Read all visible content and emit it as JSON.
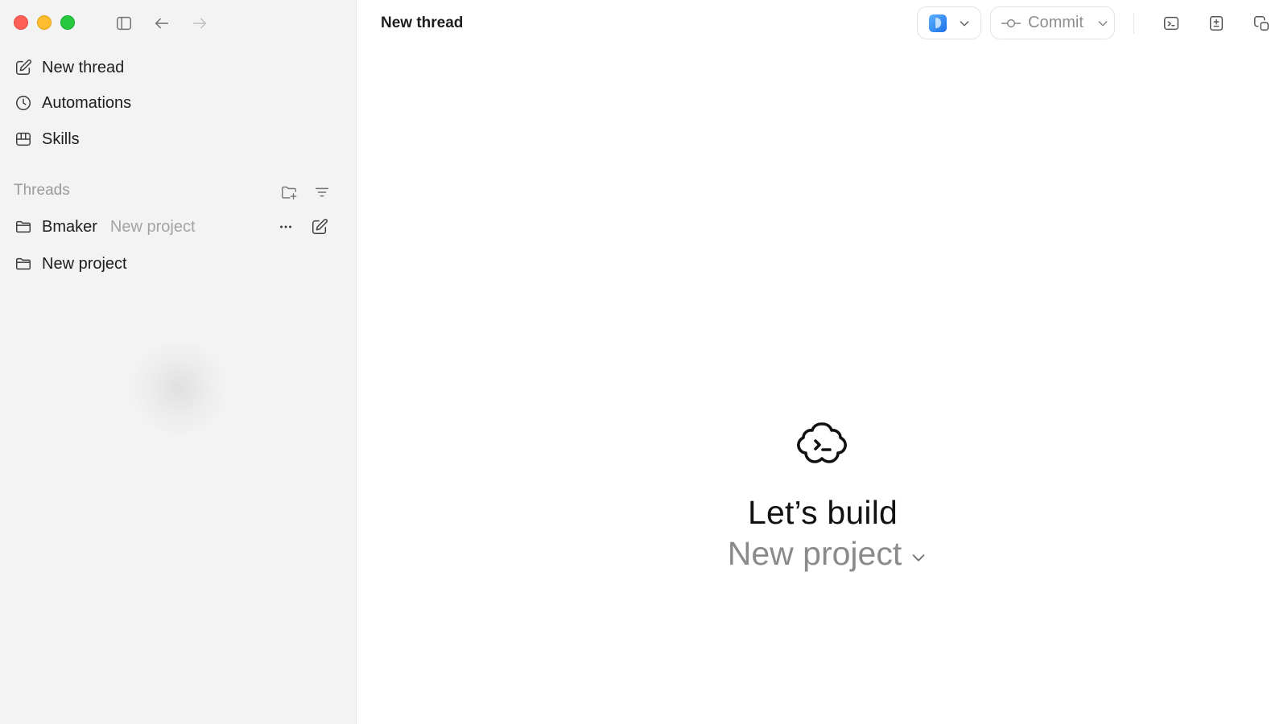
{
  "window": {
    "title": "New thread"
  },
  "sidebar": {
    "nav": [
      {
        "label": "New thread",
        "icon": "compose-icon"
      },
      {
        "label": "Automations",
        "icon": "clock-icon"
      },
      {
        "label": "Skills",
        "icon": "skills-icon"
      }
    ],
    "threads_heading": "Threads",
    "projects": [
      {
        "name": "Bmaker",
        "subtitle": "New project"
      },
      {
        "name": "New project",
        "subtitle": ""
      }
    ]
  },
  "toolbar": {
    "commit_label": "Commit"
  },
  "hero": {
    "title": "Let’s build",
    "project": "New project"
  },
  "colors": {
    "sidebar_bg": "#f3f3f3",
    "traffic_red": "#fe5f57",
    "traffic_yellow": "#febc2e",
    "traffic_green": "#28c840",
    "muted_text": "#8a8a8a"
  }
}
